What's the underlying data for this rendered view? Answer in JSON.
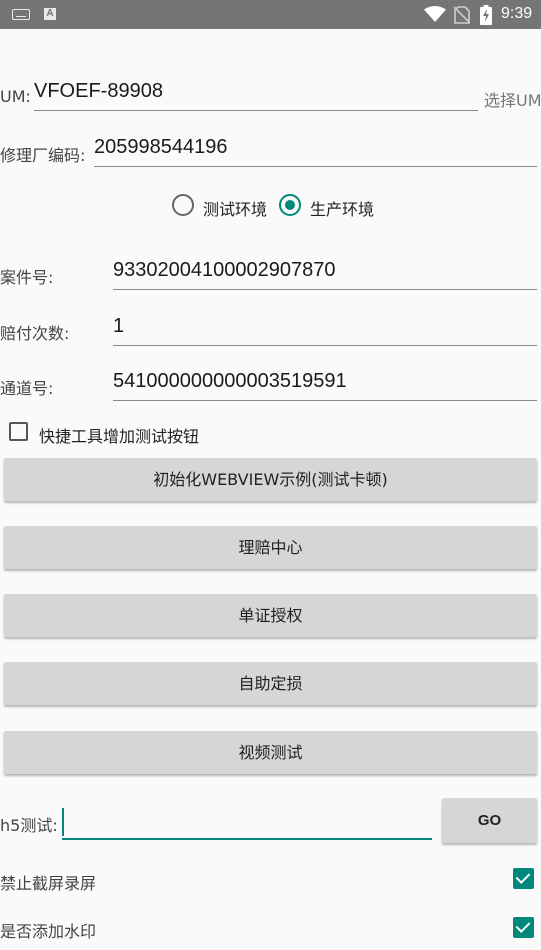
{
  "status_bar": {
    "time": "9:39",
    "left_icons": [
      "keyboard-icon",
      "a-notification-icon"
    ],
    "right_icons": [
      "wifi-icon",
      "no-sim-icon",
      "battery-charging-icon"
    ],
    "a_glyph": "A"
  },
  "um": {
    "label": "UM:",
    "value": "VFOEF-89908",
    "select_label": "选择UM"
  },
  "repair_factory": {
    "label": "修理厂编码:",
    "value": "205998544196"
  },
  "environment": {
    "options": [
      {
        "label": "测试环境",
        "selected": false
      },
      {
        "label": "生产环境",
        "selected": true
      }
    ]
  },
  "case_no": {
    "label": "案件号:",
    "value": "93302004100002907870"
  },
  "pay_count": {
    "label": "赔付次数:",
    "value": "1"
  },
  "channel_no": {
    "label": "通道号:",
    "value": "541000000000003519591"
  },
  "quick_tool": {
    "label": "快捷工具增加测试按钮",
    "checked": false
  },
  "buttons": {
    "init_webview": "初始化WEBVIEW示例(测试卡顿)",
    "claims_center": "理赔中心",
    "single_auth": "单证授权",
    "self_assess": "自助定损",
    "video_test": "视频测试"
  },
  "h5": {
    "label": "h5测试:",
    "value": "",
    "go_label": "GO"
  },
  "disable_screenshot": {
    "label": "禁止截屏录屏",
    "checked": true
  },
  "add_watermark": {
    "label": "是否添加水印",
    "checked": true
  },
  "colors": {
    "accent": "#00897b",
    "status_bar": "#757575",
    "button": "#d6d6d6"
  }
}
